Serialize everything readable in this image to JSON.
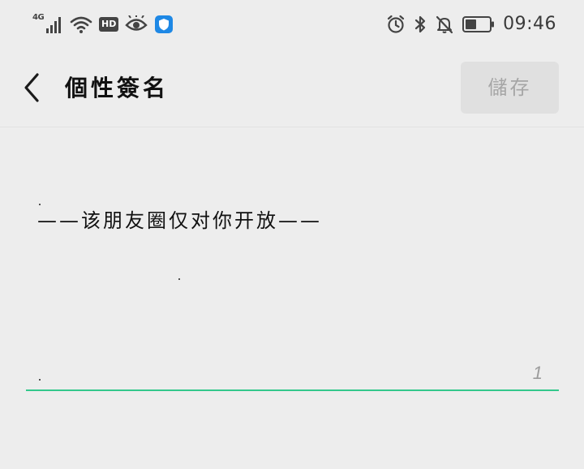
{
  "status_bar": {
    "network_type": "4G",
    "hd_label": "HD",
    "time": "09:46",
    "icons": {
      "left": [
        "signal-icon",
        "wifi-icon",
        "hd-icon",
        "eye-icon",
        "shield-app-icon"
      ],
      "right": [
        "alarm-icon",
        "bluetooth-icon",
        "bell-muted-icon",
        "battery-icon"
      ]
    },
    "colors": {
      "app_icon": "#1e88e5"
    }
  },
  "title_bar": {
    "back_icon": "chevron-left-icon",
    "title": "個性簽名",
    "save_label": "儲存"
  },
  "editor": {
    "text": "——该朋友圈仅对你开放——",
    "char_count": "1",
    "underline_color": "#33c88c"
  }
}
